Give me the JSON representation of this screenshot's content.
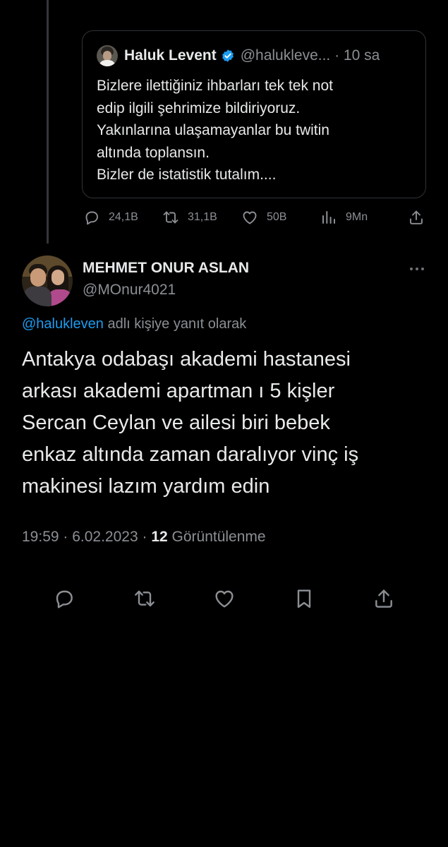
{
  "quoted_tweet": {
    "author_name": "Haluk Levent",
    "handle_and_time": "@halukleve... · 10 sa",
    "text_lines": [
      "Bizlere ilettiğiniz ihbarları tek tek not",
      "edip ilgili şehrimize bildiriyoruz.",
      "Yakınlarına ulaşamayanlar bu twitin",
      "altında toplansın.",
      "Bizler de istatistik tutalım...."
    ],
    "stats": {
      "replies": "24,1B",
      "retweets": "31,1B",
      "likes": "50B",
      "views": "9Mn"
    }
  },
  "main_tweet": {
    "author_name": "MEHMET ONUR ASLAN",
    "handle": "@MOnur4021",
    "reply_to": {
      "mention": "@halukleven",
      "suffix": " adlı kişiye yanıt olarak"
    },
    "text_lines": [
      "Antakya odabaşı akademi hastanesi",
      "arkası akademi apartman ı 5 kişler",
      "Sercan Ceylan ve ailesi biri bebek",
      "enkaz altında zaman daralıyor vinç iş",
      "makinesi lazım yardım edin"
    ],
    "timestamp": "19:59 · 6.02.2023 · ",
    "views_count": "12",
    "views_label": " Görüntülenme"
  },
  "icons": {
    "reply": "reply-icon",
    "retweet": "retweet-icon",
    "like": "heart-icon",
    "views": "views-icon",
    "share": "share-icon",
    "bookmark": "bookmark-icon",
    "more": "more-icon",
    "verified": "verified-badge-icon"
  },
  "colors": {
    "background": "#000000",
    "text": "#e7e9ea",
    "muted": "#8b8f94",
    "accent": "#1d9bf0"
  }
}
